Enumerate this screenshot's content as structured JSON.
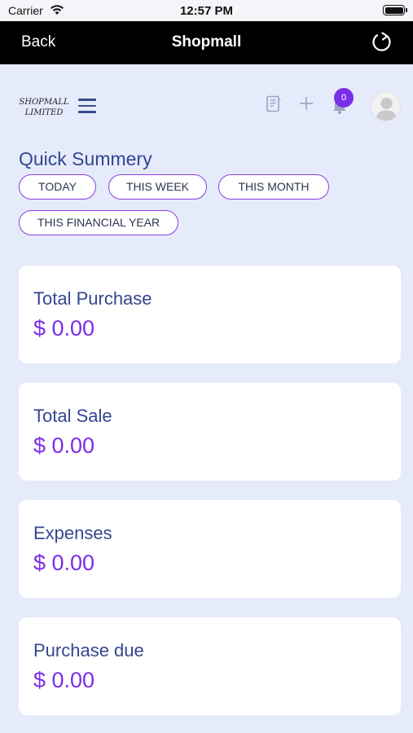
{
  "status_bar": {
    "carrier": "Carrier",
    "time": "12:57 PM"
  },
  "nav": {
    "back_label": "Back",
    "title": "Shopmall"
  },
  "header": {
    "logo_line1": "SHOPMALL",
    "logo_line2": "LIMITED",
    "notification_count": "0"
  },
  "summary": {
    "title": "Quick Summery",
    "filters": [
      "TODAY",
      "THIS WEEK",
      "THIS MONTH",
      "THIS FINANCIAL YEAR"
    ]
  },
  "cards": [
    {
      "label": "Total Purchase",
      "value": "$ 0.00"
    },
    {
      "label": "Total Sale",
      "value": "$ 0.00"
    },
    {
      "label": "Expenses",
      "value": "$ 0.00"
    },
    {
      "label": "Purchase due",
      "value": "$ 0.00"
    }
  ],
  "colors": {
    "accent": "#7b2ee8",
    "heading": "#34468f",
    "background": "#e6ebfb"
  }
}
